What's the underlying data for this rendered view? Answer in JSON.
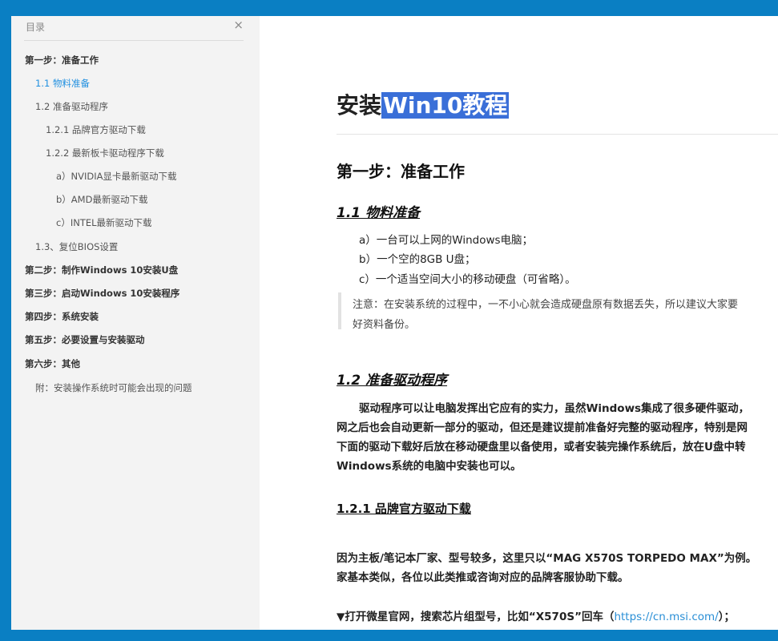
{
  "toc": {
    "title": "目录",
    "close": "×",
    "items": [
      {
        "label": "第一步：准备工作"
      },
      {
        "label": "1.1 物料准备"
      },
      {
        "label": "1.2 准备驱动程序"
      },
      {
        "label": "1.2.1 品牌官方驱动下载"
      },
      {
        "label": "1.2.2 最新板卡驱动程序下载"
      },
      {
        "label": "a）NVIDIA显卡最新驱动下载"
      },
      {
        "label": "b）AMD最新驱动下载"
      },
      {
        "label": "c）INTEL最新驱动下载"
      },
      {
        "label": "1.3、复位BIOS设置"
      },
      {
        "label": "第二步：制作Windows 10安装U盘"
      },
      {
        "label": "第三步：启动Windows 10安装程序"
      },
      {
        "label": "第四步：系统安装"
      },
      {
        "label": "第五步：必要设置与安装驱动"
      },
      {
        "label": "第六步：其他"
      },
      {
        "label": "附：安装操作系统时可能会出现的问题"
      }
    ]
  },
  "doc": {
    "title_prefix": "安装",
    "title_selected": "Win10教程",
    "h_step1": "第一步：准备工作",
    "h_11": "1.1 物料准备",
    "items": [
      "a）一台可以上网的Windows电脑；",
      "b）一个空的8GB U盘；",
      "c）一个适当空间大小的移动硬盘（可省略）。"
    ],
    "note_lines": [
      "注意：在安装系统的过程中，一不小心就会造成硬盘原有数据丢失，所以建议大家要",
      "好资料备份。"
    ],
    "h_12": "1.2 准备驱动程序",
    "para_lines": [
      "驱动程序可以让电脑发挥出它应有的实力，虽然Windows集成了很多硬件驱动，",
      "网之后也会自动更新一部分的驱动，但还是建议提前准备好完整的驱动程序，特别是网",
      "下面的驱动下载好后放在移动硬盘里以备使用，或者安装完操作系统后，放在U盘中转",
      "Windows系统的电脑中安装也可以。"
    ],
    "h_121": "1.2.1 品牌官方驱动下载",
    "para2_lines": [
      "因为主板/笔记本厂家、型号较多，这里只以“MAG X570S TORPEDO MAX”为例。",
      "家基本类似，各位以此类推或咨询对应的品牌客服协助下载。"
    ],
    "last_prefix": "▼打开微星官网，搜索芯片组型号，比如“X570S”回车（",
    "last_link": "https://cn.msi.com/",
    "last_suffix": "）；"
  }
}
